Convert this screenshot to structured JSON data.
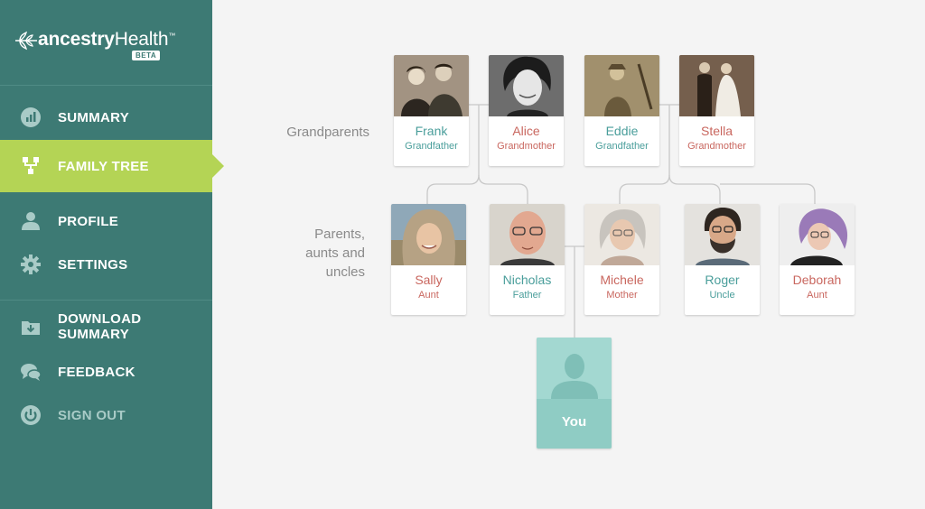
{
  "app": {
    "logo_main": "ancestry",
    "logo_sub": "Health",
    "logo_tm": "™",
    "badge": "BETA"
  },
  "sidebar": {
    "items": [
      {
        "label": "SUMMARY",
        "icon": "bar-chart-icon"
      },
      {
        "label": "FAMILY TREE",
        "icon": "family-tree-icon",
        "active": true
      },
      {
        "label": "PROFILE",
        "icon": "person-icon"
      },
      {
        "label": "SETTINGS",
        "icon": "gear-icon"
      },
      {
        "label": "DOWNLOAD SUMMARY",
        "icon": "download-icon"
      },
      {
        "label": "FEEDBACK",
        "icon": "chat-bubbles-icon"
      },
      {
        "label": "SIGN OUT",
        "icon": "power-icon"
      }
    ]
  },
  "tree": {
    "grandparents_label": "Grandparents",
    "parents_label_lines": [
      "Parents,",
      "aunts and",
      "uncles"
    ],
    "grandparents": [
      {
        "name": "Frank",
        "relation": "Grandfather",
        "tone": "teal"
      },
      {
        "name": "Alice",
        "relation": "Grandmother",
        "tone": "red"
      },
      {
        "name": "Eddie",
        "relation": "Grandfather",
        "tone": "teal"
      },
      {
        "name": "Stella",
        "relation": "Grandmother",
        "tone": "red"
      }
    ],
    "parents": [
      {
        "name": "Sally",
        "relation": "Aunt",
        "tone": "red"
      },
      {
        "name": "Nicholas",
        "relation": "Father",
        "tone": "teal"
      },
      {
        "name": "Michele",
        "relation": "Mother",
        "tone": "red"
      },
      {
        "name": "Roger",
        "relation": "Uncle",
        "tone": "teal"
      },
      {
        "name": "Deborah",
        "relation": "Aunt",
        "tone": "red"
      }
    ],
    "you_label": "You"
  },
  "colors": {
    "sidebar_bg": "#3d7a74",
    "active_bg": "#b4d455",
    "male_text": "#4a9e9b",
    "female_text": "#c9675f",
    "you_card": "#8fccc4"
  }
}
